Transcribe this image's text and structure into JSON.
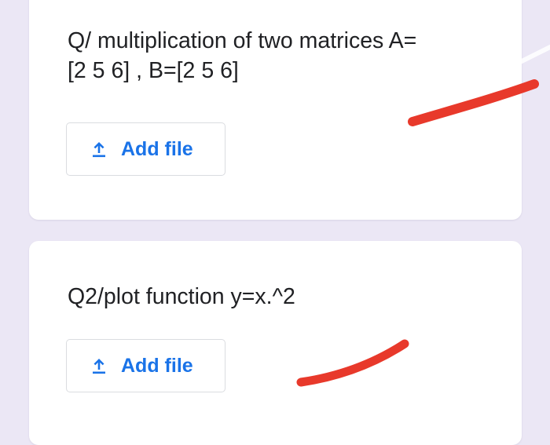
{
  "questions": [
    {
      "text": "Q/ multiplication of two matrices A=\n[2 5 6] , B=[2 5 6]",
      "add_file_label": "Add file"
    },
    {
      "text": "Q2/plot function y=x.^2",
      "add_file_label": "Add file"
    }
  ],
  "colors": {
    "page_background": "#ebe7f5",
    "card_background": "#ffffff",
    "accent": "#1a73e8",
    "annotation_marker": "#e8392b"
  },
  "icons": {
    "add_file": "upload-icon"
  }
}
